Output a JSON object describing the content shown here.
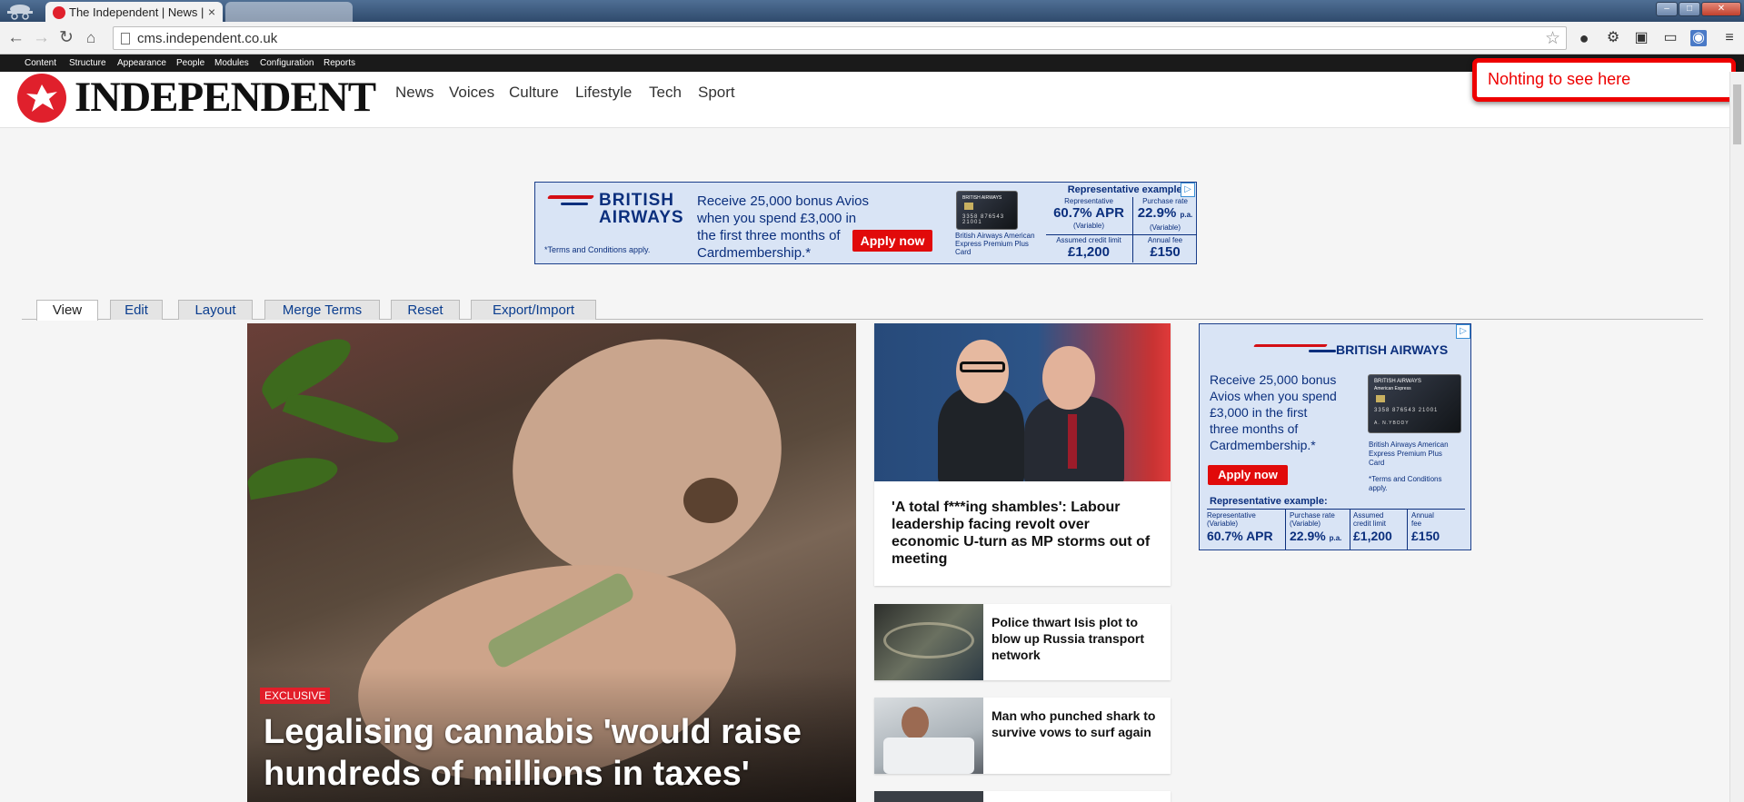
{
  "browser": {
    "tab_title": "The Independent | News |",
    "tab_close": "×",
    "url": "cms.independent.co.uk",
    "icons": [
      "back-icon",
      "forward-icon",
      "reload-icon",
      "home-icon",
      "star-icon",
      "record-icon",
      "gear-icon",
      "newspaper-icon",
      "cast-icon",
      "extension-icon",
      "menu-icon"
    ]
  },
  "admin_menu": [
    "Content",
    "Structure",
    "Appearance",
    "People",
    "Modules",
    "Configuration",
    "Reports"
  ],
  "site": {
    "logo": "INDEPENDENT",
    "nav": [
      "News",
      "Voices",
      "Culture",
      "Lifestyle",
      "Tech",
      "Sport"
    ]
  },
  "popup": {
    "message": "Nohting to see here"
  },
  "banner_ad": {
    "brand_line1": "BRITISH",
    "brand_line2": "AIRWAYS",
    "offer": "Receive 25,000 bonus Avios when you spend £3,000 in the first three months of Cardmembership.*",
    "apply": "Apply now",
    "terms": "*Terms and Conditions apply.",
    "card_name": "British Airways American Express Premium Plus Card",
    "rep_example": "Representative example:",
    "rep_label": "Representative",
    "rep_value": "60.7% APR",
    "rep_sub": "(Variable)",
    "purchase_label": "Purchase rate",
    "purchase_value": "22.9%",
    "purchase_pa": "p.a.",
    "purchase_sub": "(Variable)",
    "credit_label": "Assumed credit limit",
    "credit_value": "£1,200",
    "fee_label": "Annual fee",
    "fee_value": "£150"
  },
  "card_art": {
    "brand": "BRITISH AIRWAYS",
    "issuer": "American Express",
    "number": "3358 876543 21001",
    "holder": "A. N.YBODY"
  },
  "cms_tabs": [
    "View",
    "Edit",
    "Layout",
    "Merge Terms",
    "Reset",
    "Export/Import"
  ],
  "main_story": {
    "badge": "EXCLUSIVE",
    "headline": "Legalising cannabis 'would raise hundreds of millions in taxes'"
  },
  "featured_story": {
    "headline": "'A total f***ing shambles': Labour leadership facing revolt over economic U-turn as MP storms out of meeting"
  },
  "side_stories": [
    {
      "headline": "Police thwart Isis plot to blow up Russia transport network"
    },
    {
      "headline": "Man who punched shark to survive vows to surf again"
    }
  ],
  "mpu_ad": {
    "brand": "BRITISH AIRWAYS",
    "offer": "Receive 25,000 bonus Avios when you spend £3,000 in the first three months of Cardmembership.*",
    "apply": "Apply now",
    "card_name": "British Airways American Express Premium Plus Card",
    "terms": "*Terms and Conditions apply.",
    "rep_example": "Representative example:",
    "rep_label": "Representative (Variable)",
    "rep_value": "60.7% APR",
    "purchase_label": "Purchase rate (Variable)",
    "purchase_value": "22.9%",
    "purchase_pa": "p.a.",
    "credit_label": "Assumed credit limit",
    "credit_value": "£1,200",
    "fee_label": "Annual fee",
    "fee_value": "£150"
  },
  "colors": {
    "brand_red": "#e21e2a",
    "ba_blue": "#0b2f7d",
    "popup_red": "#ee0000"
  }
}
